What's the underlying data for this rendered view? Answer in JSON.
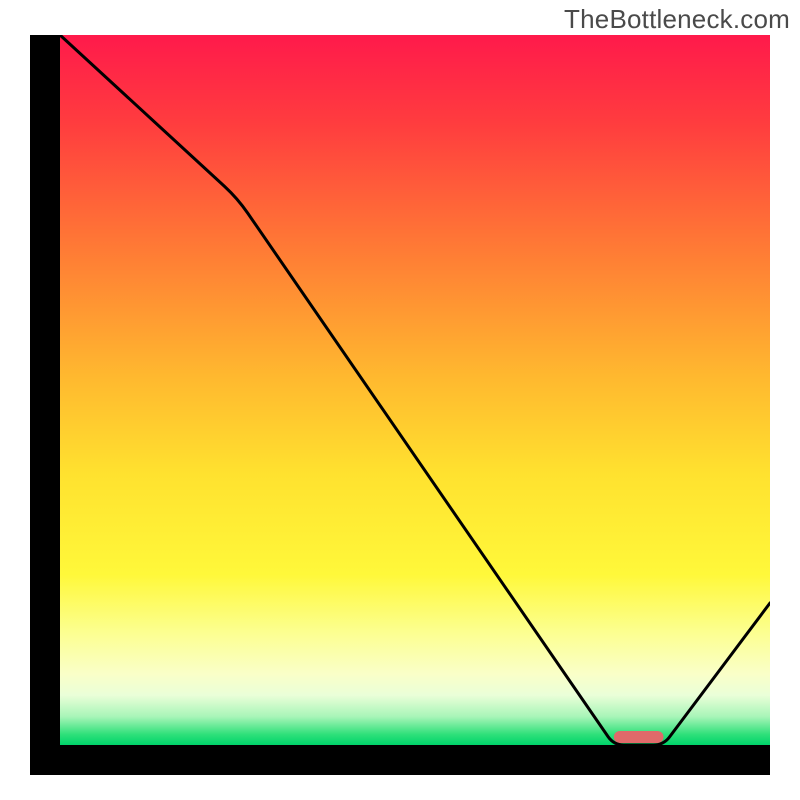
{
  "watermark": "TheBottleneck.com",
  "chart_data": {
    "type": "line",
    "xlim": [
      0,
      100
    ],
    "ylim": [
      0,
      100
    ],
    "x": [
      0,
      25,
      78,
      85,
      100
    ],
    "values": [
      100,
      77,
      0,
      0,
      20
    ],
    "title": "",
    "xlabel": "",
    "ylabel": "",
    "gradient_stops": [
      {
        "offset": 0,
        "color": "#ff1a4b"
      },
      {
        "offset": 12,
        "color": "#ff3b3f"
      },
      {
        "offset": 30,
        "color": "#ff7a35"
      },
      {
        "offset": 48,
        "color": "#ffb82f"
      },
      {
        "offset": 62,
        "color": "#ffe22f"
      },
      {
        "offset": 76,
        "color": "#fff83a"
      },
      {
        "offset": 84,
        "color": "#fcff8f"
      },
      {
        "offset": 90,
        "color": "#faffc8"
      },
      {
        "offset": 93,
        "color": "#eaffd8"
      },
      {
        "offset": 96,
        "color": "#a8f5b8"
      },
      {
        "offset": 98.5,
        "color": "#2fe07a"
      },
      {
        "offset": 100,
        "color": "#00d46a"
      }
    ],
    "marker": {
      "x_start": 78,
      "x_end": 85,
      "color": "#e06a6a"
    },
    "axis_color": "#000000",
    "line_color": "#000000",
    "line_width": 3
  }
}
